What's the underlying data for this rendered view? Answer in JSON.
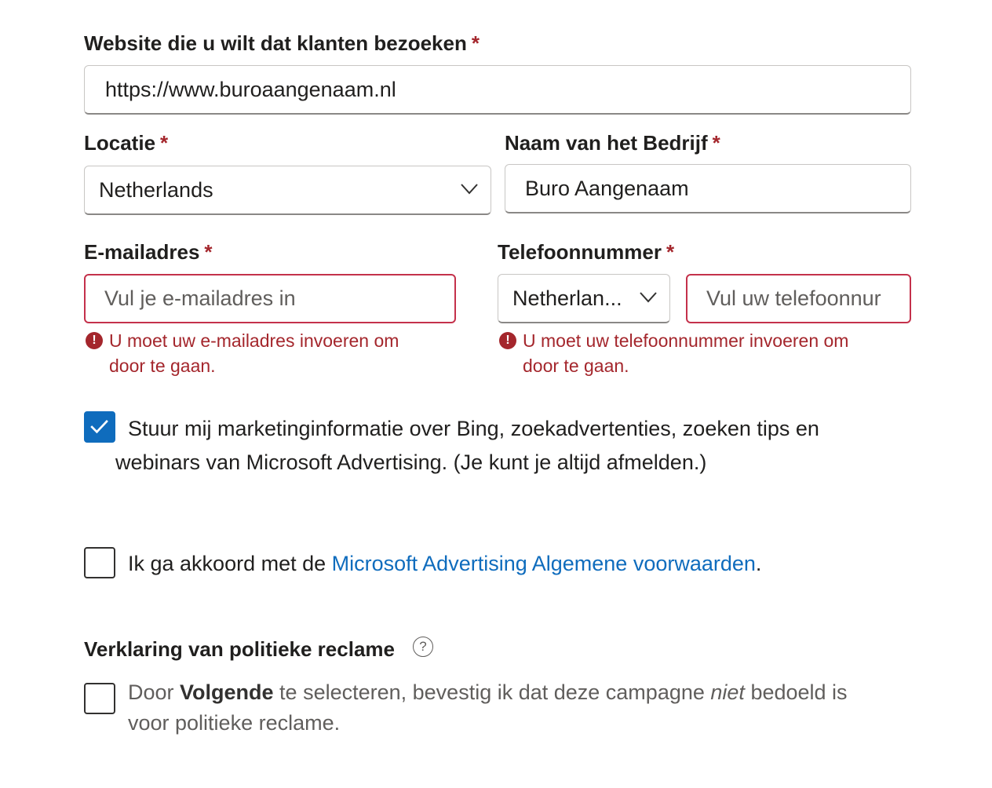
{
  "website": {
    "label": "Website die u wilt dat klanten bezoeken",
    "required_mark": "*",
    "value": "https://www.buroaangenaam.nl"
  },
  "location": {
    "label": "Locatie",
    "required_mark": "*",
    "selected": "Netherlands"
  },
  "company": {
    "label": "Naam van het Bedrijf",
    "required_mark": "*",
    "value": "Buro Aangenaam"
  },
  "email": {
    "label": "E-mailadres",
    "required_mark": "*",
    "placeholder": "Vul je e-mailadres in",
    "error_line1": "U moet uw e-mailadres invoeren om",
    "error_line2": "door te gaan."
  },
  "phone": {
    "label": "Telefoonnummer",
    "required_mark": "*",
    "country_selected": "Netherlan...",
    "placeholder": "Vul uw telefoonnur",
    "error_line1": "U moet uw telefoonnummer invoeren om",
    "error_line2": "door te gaan."
  },
  "marketing": {
    "checked": true,
    "line1": "Stuur mij marketinginformatie over Bing, zoekadvertenties, zoeken tips en",
    "line2": "webinars van Microsoft Advertising. (Je kunt je altijd afmelden.)"
  },
  "terms": {
    "checked": false,
    "prefix": "Ik ga akkoord met de ",
    "link": "Microsoft Advertising Algemene voorwaarden",
    "suffix": "."
  },
  "political": {
    "heading": "Verklaring van politieke reclame",
    "help_glyph": "?",
    "checked": false,
    "t1": "Door ",
    "t_bold": "Volgende",
    "t2": " te selecteren, bevestig ik dat deze campagne ",
    "t_italic": "niet",
    "t3": " bedoeld is",
    "line2": "voor politieke reclame."
  },
  "icons": {
    "error": "error-circle-icon",
    "chevron": "chevron-down-icon",
    "check": "checkmark-icon",
    "help": "help-circle-icon"
  },
  "colors": {
    "error": "#a4262c",
    "accent": "#0f6cbd"
  }
}
